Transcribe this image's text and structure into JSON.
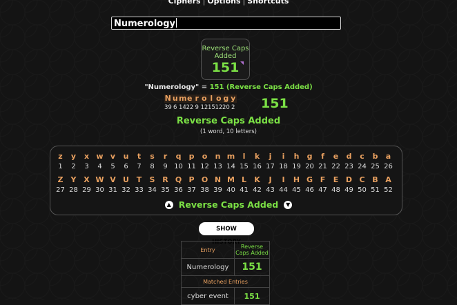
{
  "nav": {
    "items": [
      "Ciphers",
      "Options",
      "Shortcuts"
    ]
  },
  "search": {
    "value": "Numerology"
  },
  "cipher_box": {
    "name": "Reverse Caps Added",
    "value": "151"
  },
  "summary": {
    "phrase": "\"Numerology\"",
    "equals": " = ",
    "result": "151 (Reverse Caps Added)"
  },
  "breakdown": {
    "letters": [
      "N",
      "u",
      "m",
      "e",
      "r",
      "o",
      "l",
      "o",
      "g",
      "y"
    ],
    "values": [
      "39",
      "6",
      "14",
      "22",
      "9",
      "12",
      "15",
      "12",
      "20",
      "2"
    ],
    "total": "151"
  },
  "cipher_name": "Reverse Caps Added",
  "word_count": "(1 word, 10 letters)",
  "cipher_table": {
    "lower_letters": [
      "z",
      "y",
      "x",
      "w",
      "v",
      "u",
      "t",
      "s",
      "r",
      "q",
      "p",
      "o",
      "n",
      "m",
      "l",
      "k",
      "j",
      "i",
      "h",
      "g",
      "f",
      "e",
      "d",
      "c",
      "b",
      "a"
    ],
    "lower_values": [
      "1",
      "2",
      "3",
      "4",
      "5",
      "6",
      "7",
      "8",
      "9",
      "10",
      "11",
      "12",
      "13",
      "14",
      "15",
      "16",
      "17",
      "18",
      "19",
      "20",
      "21",
      "22",
      "23",
      "24",
      "25",
      "26"
    ],
    "upper_letters": [
      "Z",
      "Y",
      "X",
      "W",
      "V",
      "U",
      "T",
      "S",
      "R",
      "Q",
      "P",
      "O",
      "N",
      "M",
      "L",
      "K",
      "J",
      "I",
      "H",
      "G",
      "F",
      "E",
      "D",
      "C",
      "B",
      "A"
    ],
    "upper_values": [
      "27",
      "28",
      "29",
      "30",
      "31",
      "32",
      "33",
      "34",
      "35",
      "36",
      "37",
      "38",
      "39",
      "40",
      "41",
      "42",
      "43",
      "44",
      "45",
      "46",
      "47",
      "48",
      "49",
      "50",
      "51",
      "52"
    ],
    "title": "Reverse Caps Added"
  },
  "history_button": "SHOW HISTORY",
  "history": {
    "col_entry": "Entry",
    "col_cipher": "Reverse Caps Added",
    "rows": [
      {
        "word": "Numerology",
        "value": "151"
      }
    ],
    "matched_label": "Matched Entries",
    "matched": [
      {
        "word": "cyber event",
        "value": "151"
      }
    ]
  },
  "colors": {
    "accent_green": "#7be045",
    "accent_orange": "#e8a060",
    "background": "#141414"
  }
}
